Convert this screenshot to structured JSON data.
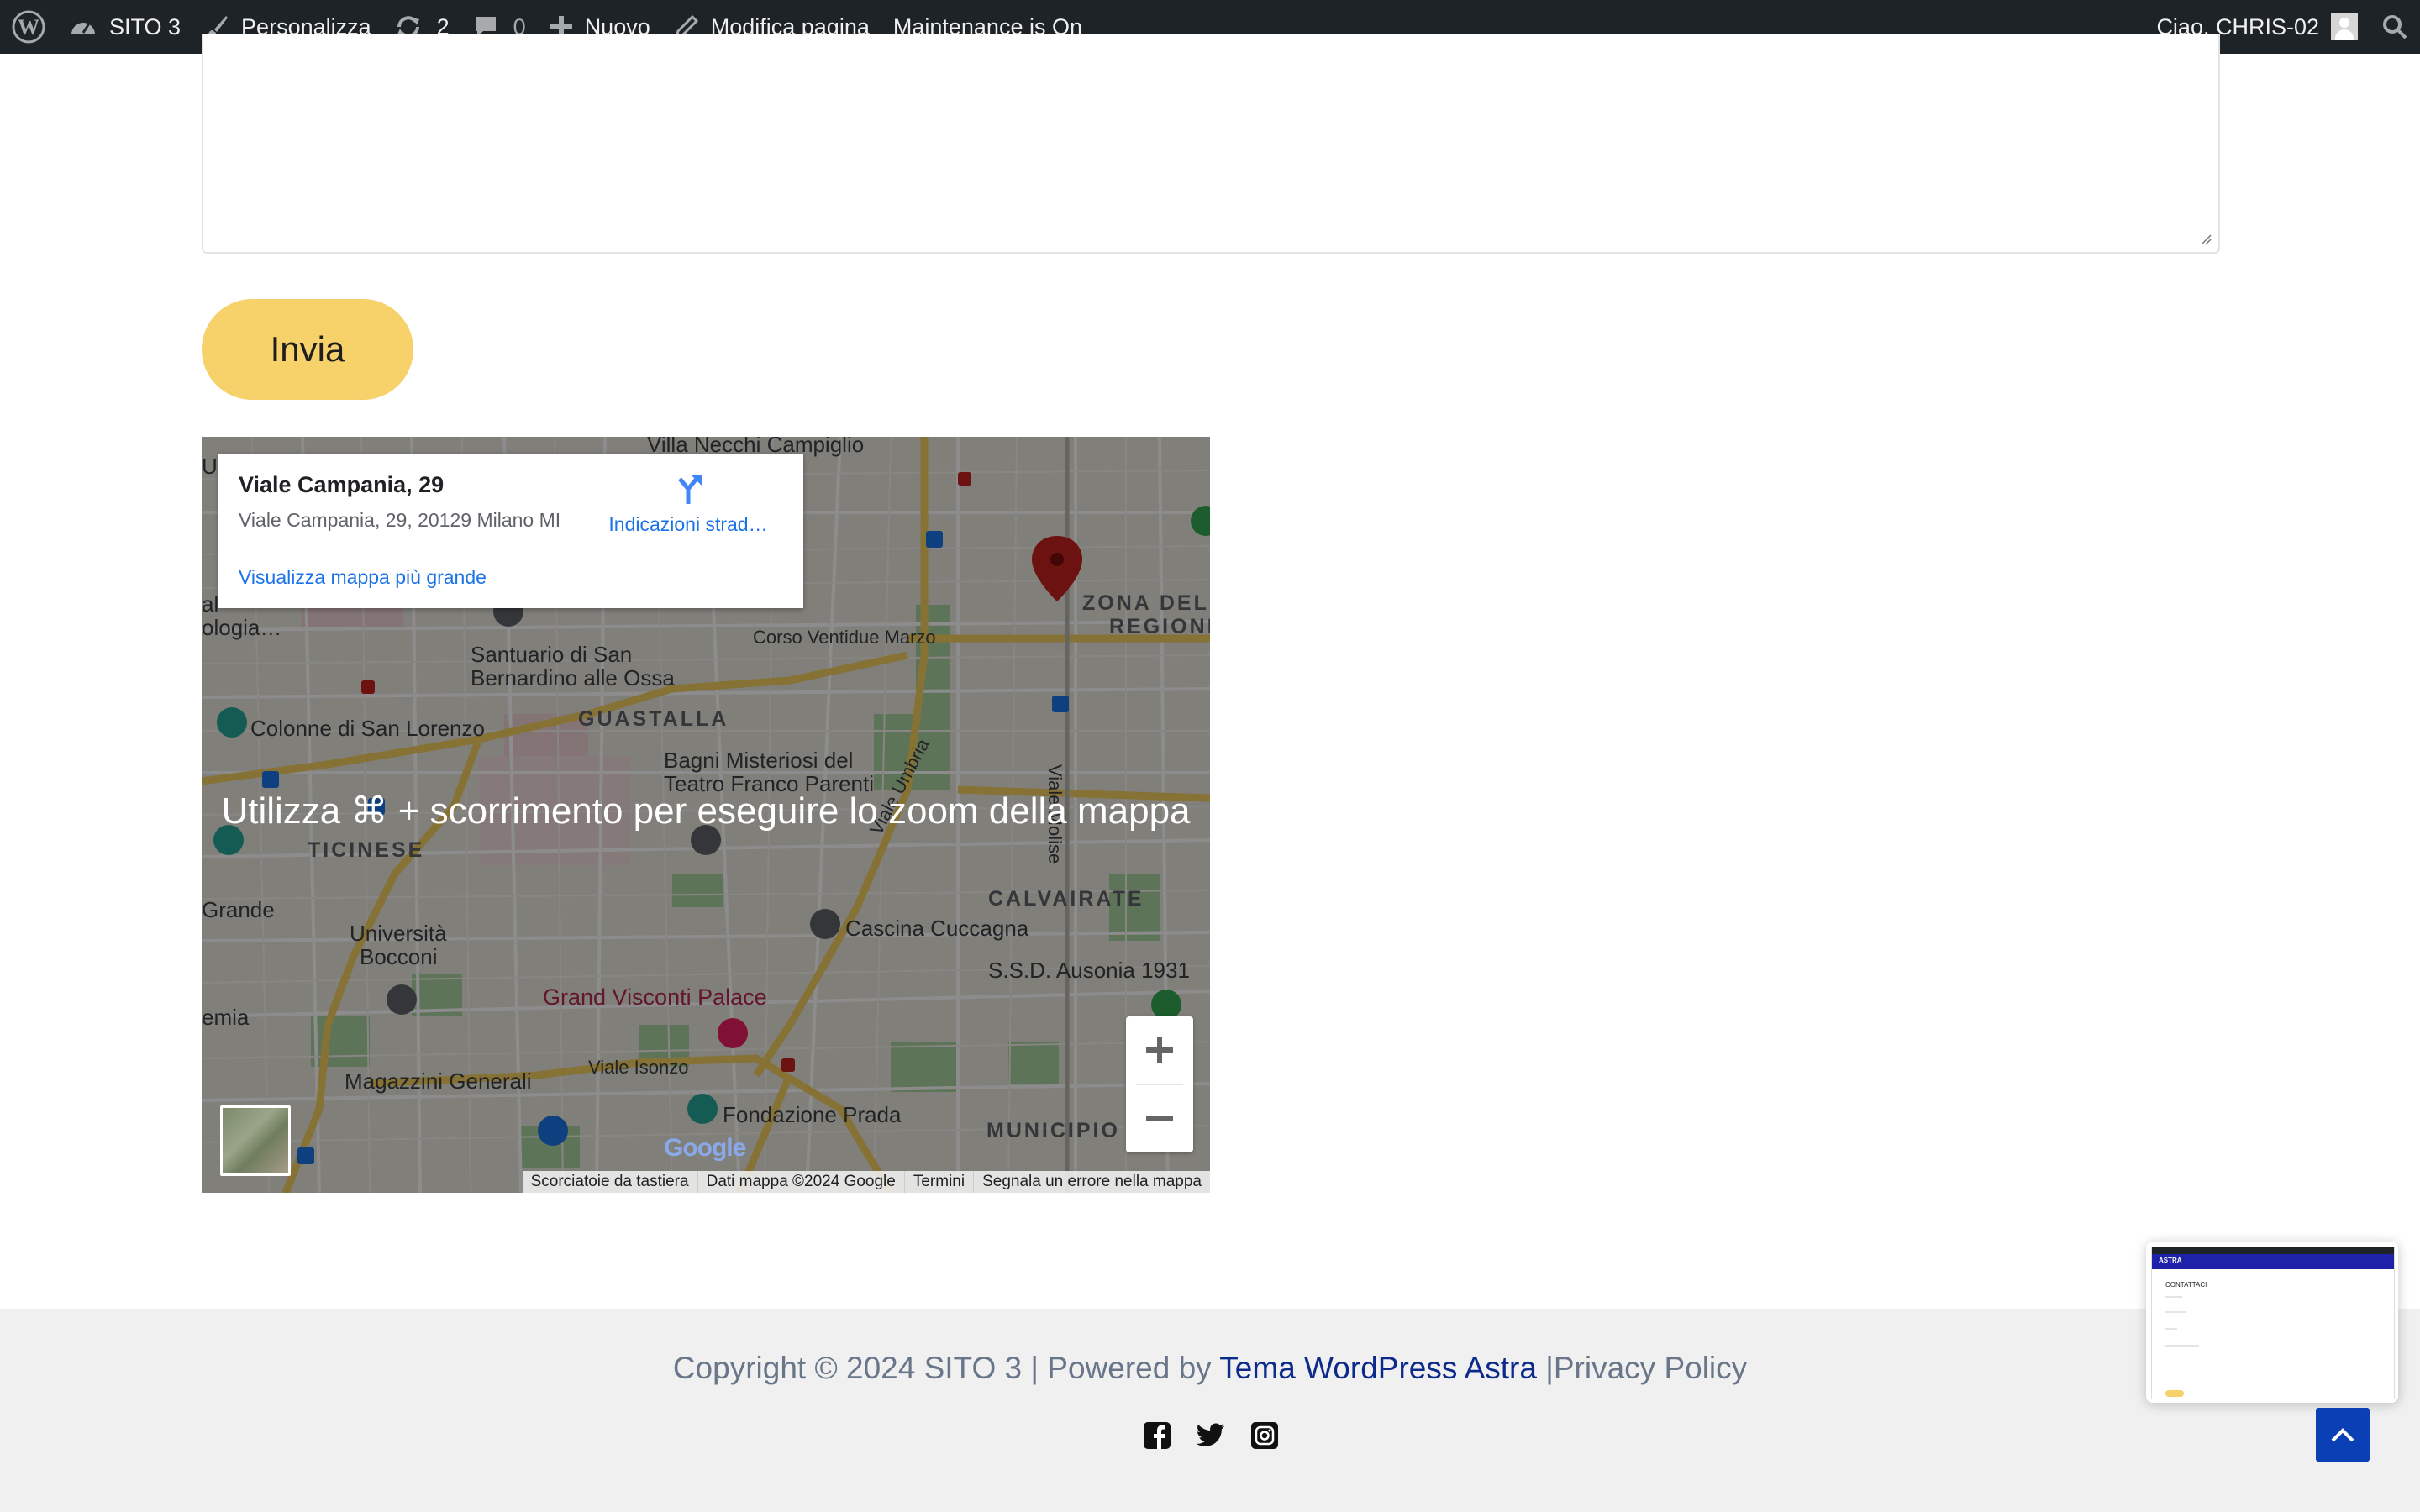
{
  "admin_bar": {
    "site_name": "SITO 3",
    "customize": "Personalizza",
    "updates_count": "2",
    "comments_count": "0",
    "new": "Nuovo",
    "edit_page": "Modifica pagina",
    "maintenance": "Maintenance is On",
    "greeting": "Ciao, CHRIS-02"
  },
  "form": {
    "submit_label": "Invia"
  },
  "map": {
    "info": {
      "title": "Viale Campania, 29",
      "address": "Viale Campania, 29, 20129 Milano MI",
      "directions": "Indicazioni strad…",
      "larger_map": "Visualizza mappa più grande"
    },
    "zoom_hint": "Utilizza ⌘ + scorrimento per eseguire lo zoom della mappa",
    "labels": {
      "villa": "Villa Necchi Campiglio",
      "zona_line1": "ZONA DELL",
      "zona_line2": "REGIONI",
      "corso": "Corso Ventidue Marzo",
      "santuario_line1": "Santuario di San",
      "santuario_line2": "Bernardino alle Ossa",
      "guastalla": "GUASTALLA",
      "colonne": "Colonne di San Lorenzo",
      "bagni_line1": "Bagni Misteriosi del",
      "bagni_line2": "Teatro Franco Parenti",
      "ticinese": "TICINESE",
      "calvairate": "CALVAIRATE",
      "cascina": "Cascina Cuccagna",
      "bocconi_line1": "Università",
      "bocconi_line2": "Bocconi",
      "ausonia": "S.S.D. Ausonia 1931",
      "grand_visconti": "Grand Visconti Palace",
      "isonzo": "Viale Isonzo",
      "magazzini": "Magazzini Generali",
      "prada": "Fondazione Prada",
      "municipio": "MUNICIPIO",
      "umbria": "Viale Umbria",
      "molise": "Viale Molise",
      "left_u": "U",
      "left_al": "al",
      "left_ologia": "ologia…",
      "left_grande": "Grande",
      "left_emia": "emia"
    },
    "google_logo": "Google",
    "attribution": [
      "Scorciatoie da tastiera",
      "Dati mappa ©2024 Google",
      "Termini",
      "Segnala un errore nella mappa"
    ]
  },
  "footer": {
    "copyright": "Copyright © 2024 SITO 3 | Powered by ",
    "theme_link": "Tema WordPress Astra",
    "separator": " |",
    "privacy": "Privacy Policy",
    "socials": [
      "facebook-icon",
      "twitter-icon",
      "instagram-icon"
    ]
  },
  "preview": {
    "brand": "ASTRA",
    "heading": "CONTATTACI"
  },
  "colors": {
    "admin_bar": "#1d2327",
    "button": "#f7d169",
    "footer_bg": "#f0f0f1",
    "footer_link": "#0b2a8a",
    "back_to_top": "#0a3fb5"
  }
}
